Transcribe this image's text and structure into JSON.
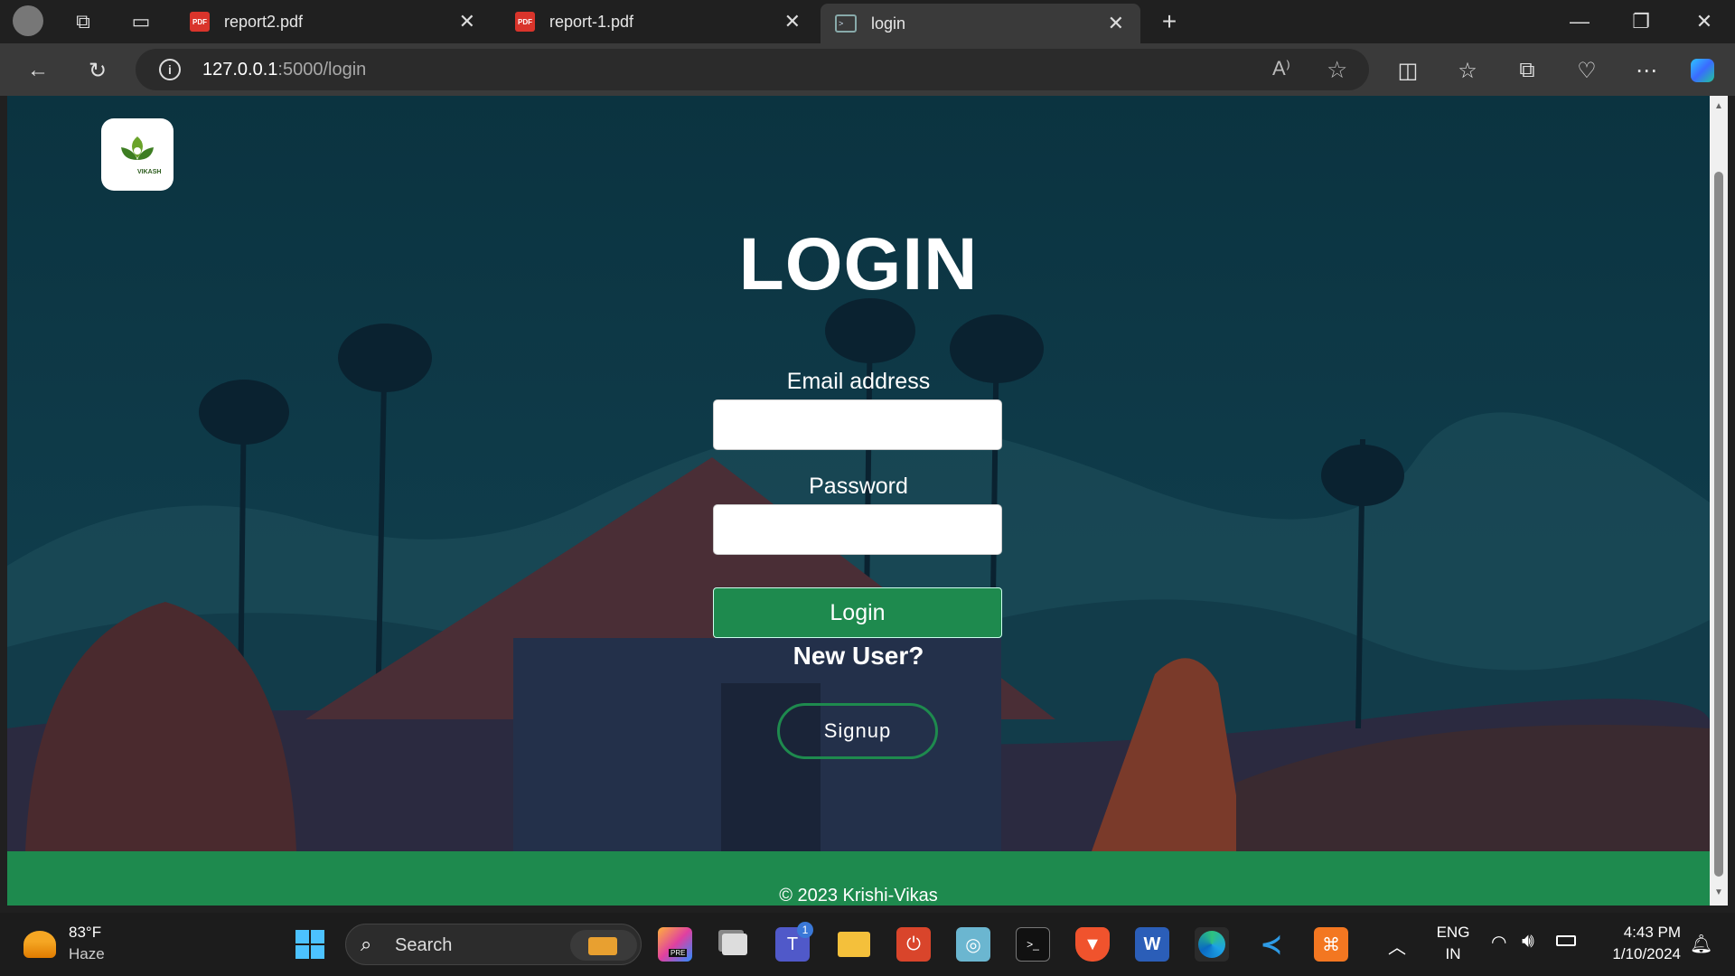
{
  "browser": {
    "tabs": [
      {
        "label": "report2.pdf",
        "icon": "pdf-icon"
      },
      {
        "label": "report-1.pdf",
        "icon": "pdf-icon"
      },
      {
        "label": "login",
        "icon": "terminal-icon"
      }
    ],
    "url_host": "127.0.0.1",
    "url_path": ":5000/login"
  },
  "page": {
    "logo_text": "VIKASH",
    "title": "LOGIN",
    "email_label": "Email address",
    "password_label": "Password",
    "login_button": "Login",
    "new_user_text": "New User?",
    "signup_button": "Signup",
    "footer_text": "© 2023 Krishi-Vikas",
    "colors": {
      "brand_green": "#1e8a4e",
      "background": "#0d3540"
    }
  },
  "taskbar": {
    "weather_temp": "83°F",
    "weather_desc": "Haze",
    "search_placeholder": "Search",
    "teams_badge": "1",
    "lang_top": "ENG",
    "lang_bottom": "IN",
    "time": "4:43 PM",
    "date": "1/10/2024"
  }
}
